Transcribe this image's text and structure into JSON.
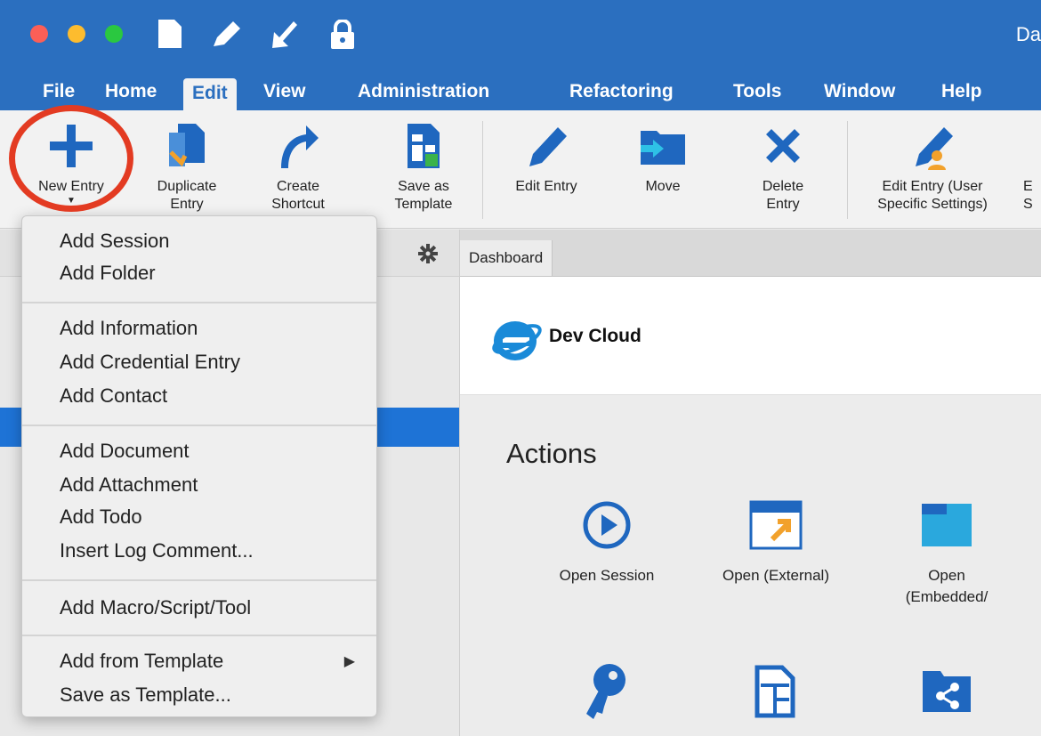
{
  "window": {
    "title": "Da"
  },
  "menubar": {
    "items": [
      {
        "label": "File"
      },
      {
        "label": "Home"
      },
      {
        "label": "Edit"
      },
      {
        "label": "View"
      },
      {
        "label": "Administration"
      },
      {
        "label": "Refactoring"
      },
      {
        "label": "Tools"
      },
      {
        "label": "Window"
      },
      {
        "label": "Help"
      }
    ]
  },
  "ribbon": {
    "new_entry": "New Entry",
    "duplicate_entry": "Duplicate\nEntry",
    "create_shortcut": "Create\nShortcut",
    "save_as_template": "Save as\nTemplate",
    "edit_entry": "Edit Entry",
    "move": "Move",
    "delete_entry": "Delete\nEntry",
    "edit_entry_user": "Edit Entry (User\nSpecific Settings)",
    "cut_label": "E\nS"
  },
  "dropdown": {
    "items": [
      "Add Session",
      "Add Folder",
      "Add Information",
      "Add Credential Entry",
      "Add Contact",
      "Add Document",
      "Add Attachment",
      "Add Todo",
      "Insert Log Comment...",
      "Add Macro/Script/Tool",
      "Add from Template",
      "Save as Template..."
    ]
  },
  "tabs": {
    "dashboard": "Dashboard"
  },
  "dashboard": {
    "entry_name": "Dev Cloud",
    "actions_title": "Actions",
    "actions": [
      {
        "label": "Open Session",
        "icon": "play-circle-icon"
      },
      {
        "label": "Open (External)",
        "icon": "external-window-icon"
      },
      {
        "label": "Open\n(Embedded/",
        "icon": "embedded-folder-icon"
      }
    ]
  },
  "colors": {
    "accent": "#2b6fbf",
    "highlight": "#e33b22",
    "selection": "#1e73d6"
  }
}
